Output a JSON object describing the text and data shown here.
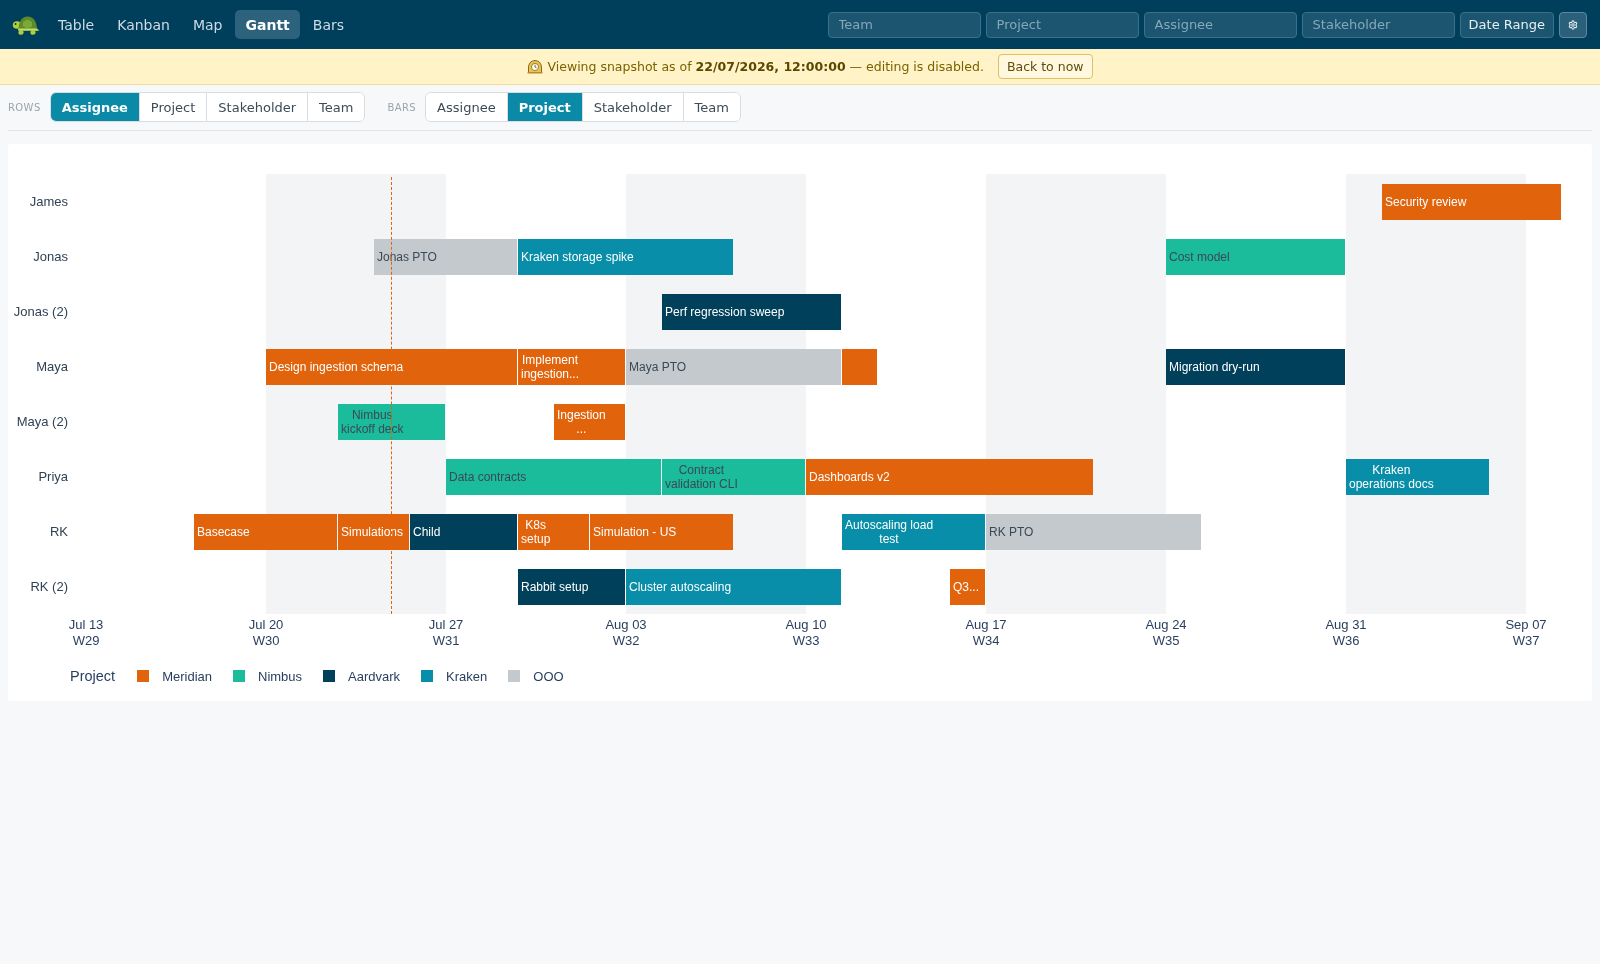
{
  "nav": [
    {
      "label": "Table",
      "selected": false
    },
    {
      "label": "Kanban",
      "selected": false
    },
    {
      "label": "Map",
      "selected": false
    },
    {
      "label": "Gantt",
      "selected": true
    },
    {
      "label": "Bars",
      "selected": false
    }
  ],
  "filters": [
    {
      "placeholder": "Team"
    },
    {
      "placeholder": "Project"
    },
    {
      "placeholder": "Assignee"
    },
    {
      "placeholder": "Stakeholder"
    }
  ],
  "date_range_button": "Date Range",
  "banner": {
    "message": "Viewing snapshot as of **22/07/2026, 12:00:00** — editing is disabled.",
    "button": "Back to now"
  },
  "toolbar": [
    {
      "label": "ROWS",
      "options": [
        {
          "label": "Assignee",
          "selected": true
        },
        {
          "label": "Project",
          "selected": false
        },
        {
          "label": "Stakeholder",
          "selected": false
        },
        {
          "label": "Team",
          "selected": false
        }
      ]
    },
    {
      "label": "BARS",
      "options": [
        {
          "label": "Assignee",
          "selected": false
        },
        {
          "label": "Project",
          "selected": true
        },
        {
          "label": "Stakeholder",
          "selected": false
        },
        {
          "label": "Team",
          "selected": false
        }
      ]
    }
  ],
  "gantt": {
    "rows": [
      {
        "label": "James",
        "bars": [
          {
            "label": "Security review",
            "color": "#e1640d"
          }
        ]
      },
      {
        "label": "Jonas",
        "bars": [
          {
            "label": "Jonas PTO",
            "color": "#c4c9ce"
          },
          {
            "label": "Kraken storage spike",
            "color": "#088ea8"
          },
          {
            "label": "Cost model",
            "color": "#1abc9c"
          }
        ]
      },
      {
        "label": "Jonas (2)",
        "bars": [
          {
            "label": "Perf regression sweep",
            "color": "#00405b"
          }
        ]
      },
      {
        "label": "Maya",
        "bars": [
          {
            "label": "Design ingestion schema",
            "color": "#e1640d"
          },
          {
            "label": "Implement\ningestion...",
            "color": "#e1640d"
          },
          {
            "label": "Maya PTO",
            "color": "#c4c9ce"
          },
          {
            "color": "#e1640d"
          },
          {
            "label": "Migration dry-run",
            "color": "#00405b"
          }
        ]
      },
      {
        "label": "Maya (2)",
        "bars": [
          {
            "label": "Nimbus\nkickoff deck",
            "color": "#1abc9c"
          },
          {
            "label": "Ingestion\n...",
            "color": "#e1640d"
          }
        ]
      },
      {
        "label": "Priya",
        "bars": [
          {
            "label": "Data contracts",
            "color": "#1abc9c"
          },
          {
            "label": "Contract\nvalidation CLI",
            "color": "#1abc9c"
          },
          {
            "label": "Dashboards v2",
            "color": "#e1640d"
          },
          {
            "label": "Kraken\noperations docs",
            "color": "#088ea8"
          }
        ]
      },
      {
        "label": "RK",
        "bars": [
          {
            "label": "Basecase",
            "color": "#e1640d"
          },
          {
            "label": "Simulations",
            "color": "#e1640d"
          },
          {
            "label": "Child",
            "color": "#00405b"
          },
          {
            "label": "K8s\nsetup",
            "color": "#e1640d"
          },
          {
            "label": "Simulation - US",
            "color": "#e1640d"
          },
          {
            "label": "Autoscaling load\ntest",
            "color": "#088ea8"
          },
          {
            "label": "RK PTO",
            "color": "#c4c9ce"
          }
        ]
      },
      {
        "label": "RK (2)",
        "bars": [
          {
            "label": "Rabbit setup",
            "color": "#00405b"
          },
          {
            "label": "Cluster autoscaling",
            "color": "#088ea8"
          },
          {
            "label": "Q3...",
            "color": "#e1640d"
          }
        ]
      }
    ],
    "axis_ticks": [
      {
        "date": "Jul 13",
        "week": "W29"
      },
      {
        "date": "Jul 20",
        "week": "W30"
      },
      {
        "date": "Jul 27",
        "week": "W31"
      },
      {
        "date": "Aug 03",
        "week": "W32"
      },
      {
        "date": "Aug 10",
        "week": "W33"
      },
      {
        "date": "Aug 17",
        "week": "W34"
      },
      {
        "date": "Aug 24",
        "week": "W35"
      },
      {
        "date": "Aug 31",
        "week": "W36"
      },
      {
        "date": "Sep 07",
        "week": "W37"
      }
    ],
    "legend": {
      "title": "Project",
      "items": [
        {
          "label": "Meridian",
          "color": "#e1640d"
        },
        {
          "label": "Nimbus",
          "color": "#1abc9c"
        },
        {
          "label": "Aardvark",
          "color": "#00405b"
        },
        {
          "label": "Kraken",
          "color": "#088ea8"
        },
        {
          "label": "OOO",
          "color": "#c4c9ce"
        }
      ]
    }
  }
}
